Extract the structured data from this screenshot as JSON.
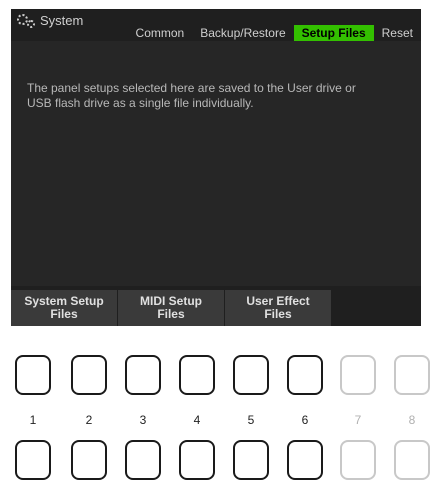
{
  "header": {
    "title": "System",
    "title_icon": "gears-icon",
    "tabs": [
      {
        "label": "Common",
        "active": false
      },
      {
        "label": "Backup/Restore",
        "active": false
      },
      {
        "label": "Setup Files",
        "active": true
      },
      {
        "label": "Reset",
        "active": false
      }
    ]
  },
  "main": {
    "description": "The panel setups selected here are saved to the User drive or\nUSB flash drive as a single file individually."
  },
  "softkeys": [
    {
      "label": "System Setup\nFiles"
    },
    {
      "label": "MIDI Setup\nFiles"
    },
    {
      "label": "User Effect\nFiles"
    },
    {
      "label": ""
    }
  ],
  "hardware_buttons": {
    "numbers": [
      "1",
      "2",
      "3",
      "4",
      "5",
      "6",
      "7",
      "8"
    ]
  },
  "colors": {
    "accent": "#33c000",
    "screen_bg": "#262626"
  }
}
